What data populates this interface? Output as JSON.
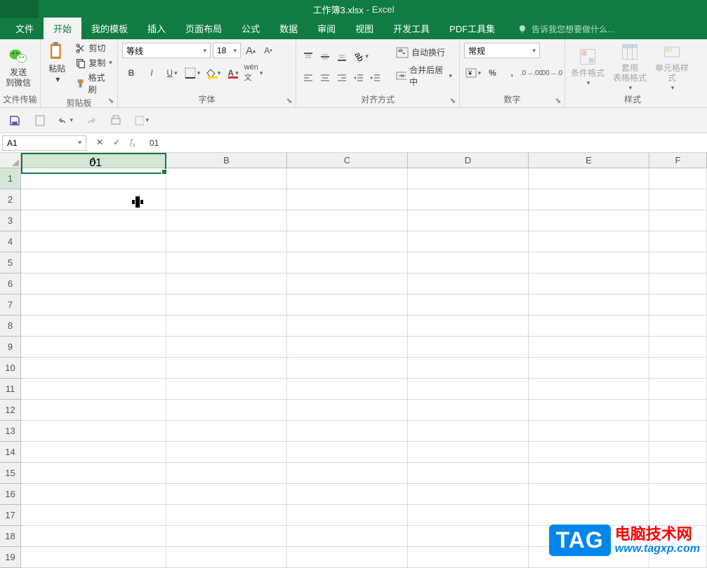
{
  "title": {
    "main": "工作簿3.xlsx",
    "sub": "- Excel"
  },
  "menu": {
    "file": "文件",
    "home": "开始",
    "templates": "我的模板",
    "insert": "插入",
    "layout": "页面布局",
    "formula": "公式",
    "data": "数据",
    "review": "审阅",
    "view": "视图",
    "dev": "开发工具",
    "pdf": "PDF工具集",
    "tellme": "告诉我您想要做什么..."
  },
  "ribbon": {
    "wechat": {
      "label": "发送\n到微信",
      "group": "文件传输"
    },
    "clipboard": {
      "paste": "粘贴",
      "cut": "剪切",
      "copy": "复制",
      "format": "格式刷",
      "group": "剪贴板"
    },
    "font": {
      "name": "等线",
      "size": "18",
      "group": "字体"
    },
    "align": {
      "wrap": "自动换行",
      "merge": "合并后居中",
      "group": "对齐方式"
    },
    "number": {
      "format": "常规",
      "group": "数字"
    },
    "styles": {
      "cond": "条件格式",
      "table": "套用\n表格格式",
      "cell": "单元格样式",
      "group": "样式"
    }
  },
  "formula": {
    "cellref": "A1",
    "value": "01"
  },
  "columns": [
    "A",
    "B",
    "C",
    "D",
    "E",
    "F"
  ],
  "rows": [
    "1",
    "2",
    "3",
    "4",
    "5",
    "6",
    "7",
    "8",
    "9",
    "10",
    "11",
    "12",
    "13",
    "14",
    "15",
    "16",
    "17",
    "18",
    "19"
  ],
  "celldata": {
    "a1": "01"
  },
  "watermark": {
    "tag": "TAG",
    "cn": "电脑技术网",
    "url": "www.tagxp.com"
  }
}
